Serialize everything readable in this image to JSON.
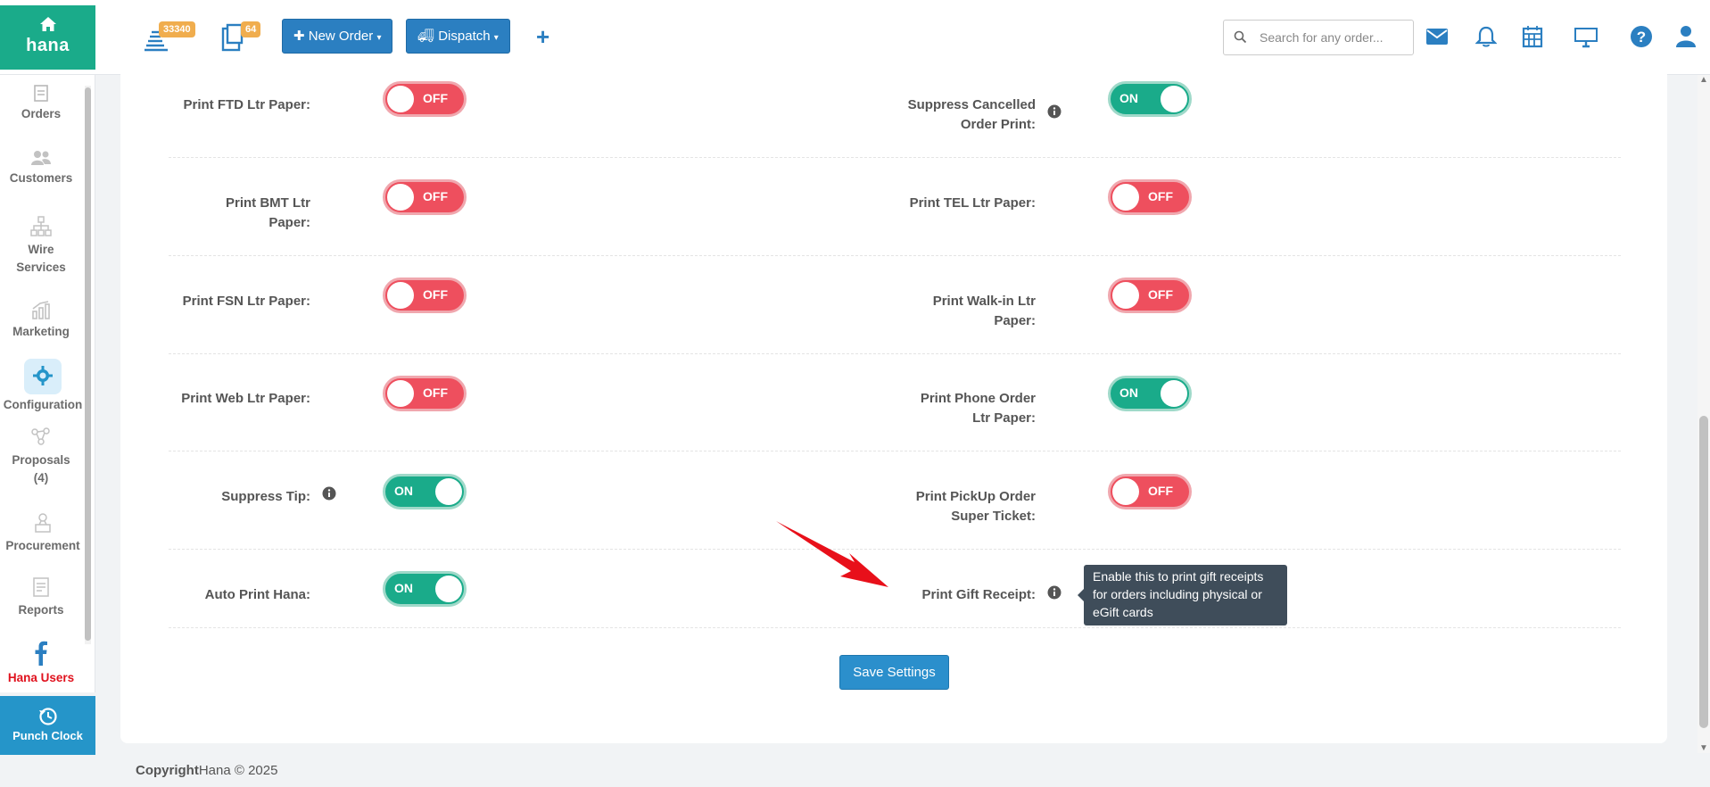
{
  "header": {
    "logo_text": "hana",
    "orders_badge": "33340",
    "tickets_badge": "64",
    "new_order_label": "New Order",
    "dispatch_label": "Dispatch",
    "search_placeholder": "Search for any order..."
  },
  "sidebar": {
    "items": [
      {
        "label": "Orders"
      },
      {
        "label": "Customers"
      },
      {
        "label": "Wire Services"
      },
      {
        "label": "Marketing"
      },
      {
        "label": "Configuration"
      },
      {
        "label": "Proposals (4)"
      },
      {
        "label": "Procurement"
      },
      {
        "label": "Reports"
      },
      {
        "label": "Hana Users"
      }
    ],
    "punch_clock_label": "Punch Clock"
  },
  "settings": {
    "left": [
      {
        "label": "Print FTD Ltr Paper:",
        "state": "OFF"
      },
      {
        "label": "Print BMT Ltr Paper:",
        "state": "OFF"
      },
      {
        "label": "Print FSN Ltr Paper:",
        "state": "OFF"
      },
      {
        "label": "Print Web Ltr Paper:",
        "state": "OFF"
      },
      {
        "label": "Suppress Tip:",
        "state": "ON"
      },
      {
        "label": "Auto Print Hana:",
        "state": "ON"
      }
    ],
    "right": [
      {
        "label": "Suppress Cancelled Order Print:",
        "state": "ON"
      },
      {
        "label": "Print TEL Ltr Paper:",
        "state": "OFF"
      },
      {
        "label": "Print Walk-in Ltr Paper:",
        "state": "OFF"
      },
      {
        "label": "Print Phone Order Ltr Paper:",
        "state": "ON"
      },
      {
        "label": "Print PickUp Order Super Ticket:",
        "state": "OFF"
      },
      {
        "label": "Print Gift Receipt:",
        "state": ""
      }
    ],
    "tooltip": "Enable this to print gift receipts for orders including physical or eGift cards",
    "save_label": "Save Settings"
  },
  "footer": {
    "copyright_bold": "Copyright",
    "copyright_text": "Hana © 2025"
  },
  "colors": {
    "brand": "#1aab8a",
    "on": "#1aab8a",
    "off": "#ee4f5e",
    "primary_button": "#2b7fc1"
  }
}
